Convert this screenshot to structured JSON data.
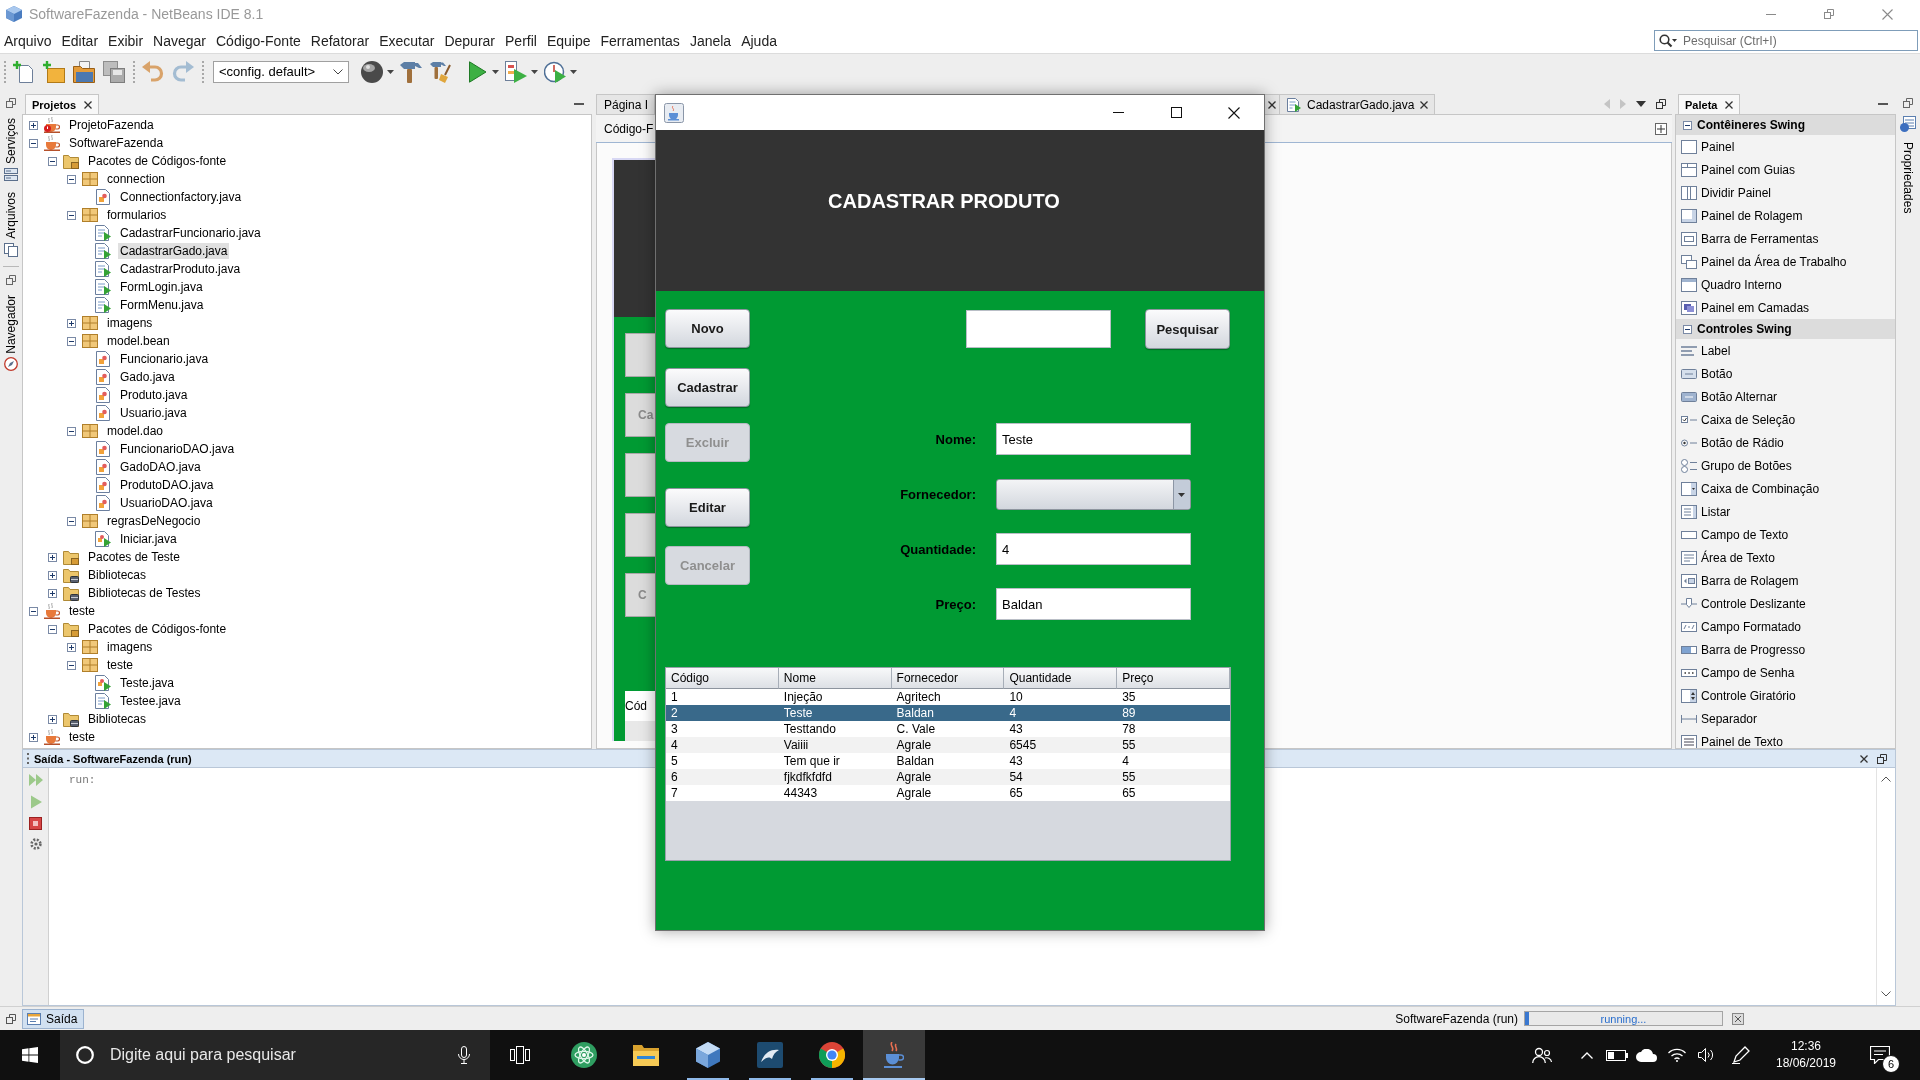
{
  "window": {
    "title": "SoftwareFazenda - NetBeans IDE 8.1"
  },
  "menu": [
    "Arquivo",
    "Editar",
    "Exibir",
    "Navegar",
    "Código-Fonte",
    "Refatorar",
    "Executar",
    "Depurar",
    "Perfil",
    "Equipe",
    "Ferramentas",
    "Janela",
    "Ajuda"
  ],
  "quick_search": {
    "placeholder": "Pesquisar (Ctrl+I)"
  },
  "toolbar": {
    "configuration": "<config. default>"
  },
  "left_side_tabs": [
    "Serviços",
    "Arquivos",
    "Navegador"
  ],
  "projects": {
    "title": "Projetos",
    "tree": [
      {
        "label": "ProjetoFazenda",
        "kind": "project",
        "error": true,
        "expanded": false,
        "selected": false
      },
      {
        "label": "SoftwareFazenda",
        "kind": "project",
        "error": false,
        "expanded": true,
        "selected": false,
        "children": [
          {
            "label": "Pacotes de Códigos-fonte",
            "kind": "source-folder",
            "expanded": true,
            "selected": false,
            "children": [
              {
                "label": "connection",
                "kind": "package",
                "expanded": true,
                "selected": false,
                "children": [
                  {
                    "label": "Connectionfactory.java",
                    "kind": "class",
                    "selected": false
                  }
                ]
              },
              {
                "label": "formularios",
                "kind": "package",
                "expanded": true,
                "selected": false,
                "children": [
                  {
                    "label": "CadastrarFuncionario.java",
                    "kind": "form",
                    "selected": false
                  },
                  {
                    "label": "CadastrarGado.java",
                    "kind": "form",
                    "selected": true
                  },
                  {
                    "label": "CadastrarProduto.java",
                    "kind": "form",
                    "selected": false
                  },
                  {
                    "label": "FormLogin.java",
                    "kind": "form",
                    "selected": false
                  },
                  {
                    "label": "FormMenu.java",
                    "kind": "form",
                    "selected": false
                  }
                ]
              },
              {
                "label": "imagens",
                "kind": "package",
                "expanded": false,
                "selected": false
              },
              {
                "label": "model.bean",
                "kind": "package",
                "expanded": true,
                "selected": false,
                "children": [
                  {
                    "label": "Funcionario.java",
                    "kind": "class",
                    "selected": false
                  },
                  {
                    "label": "Gado.java",
                    "kind": "class",
                    "selected": false
                  },
                  {
                    "label": "Produto.java",
                    "kind": "class",
                    "selected": false
                  },
                  {
                    "label": "Usuario.java",
                    "kind": "class",
                    "selected": false
                  }
                ]
              },
              {
                "label": "model.dao",
                "kind": "package",
                "expanded": true,
                "selected": false,
                "children": [
                  {
                    "label": "FuncionarioDAO.java",
                    "kind": "class",
                    "selected": false
                  },
                  {
                    "label": "GadoDAO.java",
                    "kind": "class",
                    "selected": false
                  },
                  {
                    "label": "ProdutoDAO.java",
                    "kind": "class",
                    "selected": false
                  },
                  {
                    "label": "UsuarioDAO.java",
                    "kind": "class",
                    "selected": false
                  }
                ]
              },
              {
                "label": "regrasDeNegocio",
                "kind": "package",
                "expanded": true,
                "selected": false,
                "children": [
                  {
                    "label": "Iniciar.java",
                    "kind": "main-class",
                    "selected": false
                  }
                ]
              }
            ]
          },
          {
            "label": "Pacotes de Teste",
            "kind": "source-folder",
            "expanded": false,
            "selected": false
          },
          {
            "label": "Bibliotecas",
            "kind": "library",
            "expanded": false,
            "selected": false
          },
          {
            "label": "Bibliotecas de Testes",
            "kind": "library",
            "expanded": false,
            "selected": false
          }
        ]
      },
      {
        "label": "teste",
        "kind": "project",
        "error": false,
        "expanded": true,
        "selected": false,
        "children": [
          {
            "label": "Pacotes de Códigos-fonte",
            "kind": "source-folder",
            "expanded": true,
            "selected": false,
            "children": [
              {
                "label": "imagens",
                "kind": "package",
                "expanded": false,
                "selected": false
              },
              {
                "label": "teste",
                "kind": "package",
                "expanded": true,
                "selected": false,
                "children": [
                  {
                    "label": "Teste.java",
                    "kind": "main-class",
                    "selected": false
                  },
                  {
                    "label": "Testee.java",
                    "kind": "form",
                    "selected": false
                  }
                ]
              }
            ]
          },
          {
            "label": "Bibliotecas",
            "kind": "library",
            "expanded": false,
            "selected": false
          }
        ]
      },
      {
        "label": "teste",
        "kind": "project",
        "error": false,
        "expanded": false,
        "selected": false
      }
    ]
  },
  "editor": {
    "tabs": [
      {
        "label": "Página I",
        "selected": false
      },
      {
        "label": "CadastrarGado.java",
        "selected": false
      }
    ],
    "view_tab": "Código-F",
    "form_preview": {
      "buttons": [
        {
          "kind": "blank"
        },
        {
          "kind": "labelled",
          "label": "Ca"
        },
        {
          "kind": "blank"
        },
        {
          "kind": "blank"
        },
        {
          "kind": "labelled",
          "label": "C"
        }
      ],
      "table_header": "Cód"
    }
  },
  "palette": {
    "title": "Paleta",
    "sections": [
      {
        "title": "Contêineres Swing",
        "expanded": true,
        "items": [
          {
            "label": "Painel",
            "kind": "panel"
          },
          {
            "label": "Painel com Guias",
            "kind": "tabs"
          },
          {
            "label": "Dividir Painel",
            "kind": "split"
          },
          {
            "label": "Painel de Rolagem",
            "kind": "scroll-pane"
          },
          {
            "label": "Barra de Ferramentas",
            "kind": "toolbar"
          },
          {
            "label": "Painel da Área de Trabalho",
            "kind": "desktop"
          },
          {
            "label": "Quadro Interno",
            "kind": "frame"
          },
          {
            "label": "Painel em Camadas",
            "kind": "layers"
          }
        ]
      },
      {
        "title": "Controles Swing",
        "expanded": true,
        "items": [
          {
            "label": "Label",
            "kind": "label"
          },
          {
            "label": "Botão",
            "kind": "button"
          },
          {
            "label": "Botão Alternar",
            "kind": "toggle"
          },
          {
            "label": "Caixa de Seleção",
            "kind": "checkbox"
          },
          {
            "label": "Botão de Rádio",
            "kind": "radio"
          },
          {
            "label": "Grupo de Botões",
            "kind": "group"
          },
          {
            "label": "Caixa de Combinação",
            "kind": "combo"
          },
          {
            "label": "Listar",
            "kind": "list"
          },
          {
            "label": "Campo de Texto",
            "kind": "text-field"
          },
          {
            "label": "Área de Texto",
            "kind": "text-area"
          },
          {
            "label": "Barra de Rolagem",
            "kind": "scrollbar"
          },
          {
            "label": "Controle Deslizante",
            "kind": "slider"
          },
          {
            "label": "Campo Formatado",
            "kind": "formatted"
          },
          {
            "label": "Barra de Progresso",
            "kind": "progress"
          },
          {
            "label": "Campo de Senha",
            "kind": "password"
          },
          {
            "label": "Controle Giratório",
            "kind": "spinner"
          },
          {
            "label": "Separador",
            "kind": "separator"
          },
          {
            "label": "Painel de Texto",
            "kind": "text-pane"
          }
        ]
      }
    ]
  },
  "right_side_tabs": [
    "Propriedades"
  ],
  "dialog": {
    "heading": "CADASTRAR PRODUTO",
    "buttons": [
      {
        "label": "Novo",
        "disabled": false
      },
      {
        "label": "Cadastrar",
        "disabled": false
      },
      {
        "label": "Excluir",
        "disabled": true
      },
      {
        "label": "Editar",
        "disabled": false
      },
      {
        "label": "Cancelar",
        "disabled": true
      }
    ],
    "search_button": "Pesquisar",
    "fields": [
      {
        "label": "Nome:",
        "kind": "text",
        "value": "Teste"
      },
      {
        "label": "Fornecedor:",
        "kind": "combo"
      },
      {
        "label": "Quantidade:",
        "kind": "text",
        "value": "4"
      },
      {
        "label": "Preço:",
        "kind": "text",
        "value": "Baldan"
      }
    ],
    "table": {
      "columns": [
        "Código",
        "Nome",
        "Fornecedor",
        "Quantidade",
        "Preço"
      ],
      "rows": [
        {
          "cells": [
            "1",
            "Injeção",
            "Agritech",
            "10",
            "35"
          ],
          "selected": false
        },
        {
          "cells": [
            "2",
            "Teste",
            "Baldan",
            "4",
            "89"
          ],
          "selected": true
        },
        {
          "cells": [
            "3",
            "Testtando",
            "C. Vale",
            "43",
            "78"
          ],
          "selected": false
        },
        {
          "cells": [
            "4",
            "Vaiiii",
            "Agrale",
            "6545",
            "55"
          ],
          "selected": false
        },
        {
          "cells": [
            "5",
            "Tem que ir",
            "Baldan",
            "43",
            "4"
          ],
          "selected": false
        },
        {
          "cells": [
            "6",
            "fjkdfkfdfd",
            "Agrale",
            "54",
            "55"
          ],
          "selected": false
        },
        {
          "cells": [
            "7",
            "44343",
            "Agrale",
            "65",
            "65"
          ],
          "selected": false
        }
      ]
    }
  },
  "output": {
    "title": "Saída - SoftwareFazenda (run)",
    "lines": [
      "run:"
    ]
  },
  "status_bar": {
    "output_tab": "Saída",
    "task": "SoftwareFazenda (run)",
    "progress": {
      "text": "running...",
      "level": 0.02
    }
  },
  "taskbar": {
    "search_placeholder": "Digite aqui para pesquisar",
    "apps": [
      {
        "kind": "atom",
        "open": false,
        "selected": false
      },
      {
        "kind": "folder",
        "open": false,
        "selected": false
      },
      {
        "kind": "cube",
        "open": true,
        "selected": false
      },
      {
        "kind": "swoosh",
        "open": true,
        "selected": false
      },
      {
        "kind": "browser",
        "open": true,
        "selected": false
      },
      {
        "kind": "cup",
        "open": true,
        "selected": true
      }
    ],
    "time": "12:36",
    "date": "18/06/2019",
    "notifications": "6"
  }
}
